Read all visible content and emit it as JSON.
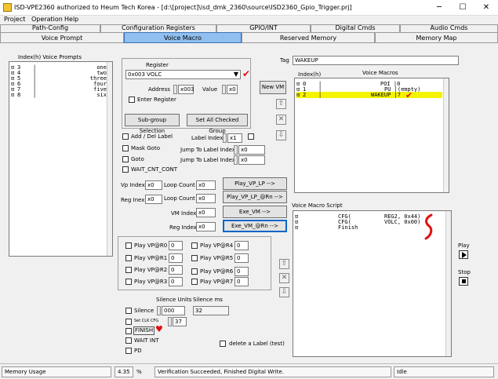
{
  "window": {
    "title": "ISD-VPE2360 authorized to Heum Tech Korea - [d:\\[project]\\isd_dmk_2360\\source\\ISD2360_Gpio_Trigger.prj]",
    "minimize": "─",
    "maximize": "☐",
    "close": "✕"
  },
  "menu": [
    "Project",
    "Operation",
    "Help"
  ],
  "tabs_row1": [
    "Path-Config",
    "Configuration Registers",
    "GPIO/INT",
    "Digital Cmds",
    "Audio Cmds"
  ],
  "tabs_row2": [
    "Voice Prompt",
    "Voice Macro",
    "Reserved Memory",
    "Memory Map"
  ],
  "active_tab": "Voice Macro",
  "prompts": {
    "header": "Index(h)  Voice Prompts",
    "rows": [
      {
        "idx": "3",
        "name": "one"
      },
      {
        "idx": "4",
        "name": "two"
      },
      {
        "idx": "5",
        "name": "three"
      },
      {
        "idx": "6",
        "name": "four"
      },
      {
        "idx": "7",
        "name": "five"
      },
      {
        "idx": "8",
        "name": "six"
      }
    ]
  },
  "register": {
    "label": "Register",
    "selected": "0x003 VOLC",
    "address_label": "Address",
    "address_value": "x003",
    "value_label": "Value",
    "value_value": "x0",
    "enter_register": "Enter Register",
    "subgroup_button": "Sub-group Selection",
    "set_all_button": "Set All Checked Group"
  },
  "tag": {
    "label": "Tag",
    "value": "WAKEUP"
  },
  "new_vm": "New VM",
  "macros": {
    "index_header": "Index(h)",
    "header": "Voice Macros",
    "rows": [
      {
        "idx": "0",
        "name": "POI |0"
      },
      {
        "idx": "1",
        "name": "PU |(empty)"
      },
      {
        "idx": "2",
        "name": "WAKEUP |7"
      }
    ],
    "selected_row": 2
  },
  "labels": {
    "add_del": "Add / Del Label",
    "label_index": "Label Index",
    "label_index_value": "x1",
    "mask_goto": "Mask Goto",
    "jump_label_1": "Jump To Label Index",
    "jump_value_1": "x0",
    "goto": "Goto",
    "jump_label_2": "Jump To Label Index",
    "jump_value_2": "x0",
    "wait_cnt": "WAIT_CNT_CONT"
  },
  "play": {
    "vp_index_label": "Vp Index",
    "vp_index_value": "x0",
    "loop_count_label": "Loop Count",
    "loop_count_value": "x0",
    "play_vp_lp": "Play_VP_LP  -->",
    "reg_index_label": "Reg Inex",
    "reg_index_value": "x0",
    "loop_count2_label": "Loop Count",
    "loop_count2_value": "x0",
    "play_vp_rn": "Play_VP_LP_@Rn  -->",
    "vm_index_label": "VM Index",
    "vm_index_value": "x0",
    "exe_vm": "Exe_VM  -->",
    "reg_index2_label": "Reg Index",
    "reg_index2_value": "x0",
    "exe_vm_rn": "Exe_VM_@Rn  -->"
  },
  "play_rn": [
    {
      "label": "Play VP@R0",
      "value": "0"
    },
    {
      "label": "Play VP@R4",
      "value": "0"
    },
    {
      "label": "Play VP@R1",
      "value": "0"
    },
    {
      "label": "Play VP@R5",
      "value": "0"
    },
    {
      "label": "Play VP@R2",
      "value": "0"
    },
    {
      "label": "Play VP@R6",
      "value": "0"
    },
    {
      "label": "Play VP@R3",
      "value": "0"
    },
    {
      "label": "Play VP@R7",
      "value": "0"
    }
  ],
  "silence": {
    "units_label": "Silence Units",
    "ms_label": "Silence ms",
    "silence": "Silence",
    "silence_value": "000",
    "silence_ms_value": "32",
    "set_clk": "Set CLK CFG",
    "set_clk_value": "37",
    "finish": "FINISH",
    "wait_int": "WAIT INT",
    "pd": "PD",
    "delete_label": "delete a Label (test)"
  },
  "script": {
    "title": "Voice Macro Script",
    "rows": [
      "CFG(          REG2, 0x44)",
      "CFG(          VOLC, 0x00)",
      "Finish"
    ]
  },
  "side": {
    "play": "Play",
    "stop": "Stop"
  },
  "status": {
    "memory_usage": "Memory Usage",
    "percent": "4.35",
    "unit": "%",
    "message": "Verification Succeeded, Finished Digital Write.",
    "state": "Idle"
  }
}
